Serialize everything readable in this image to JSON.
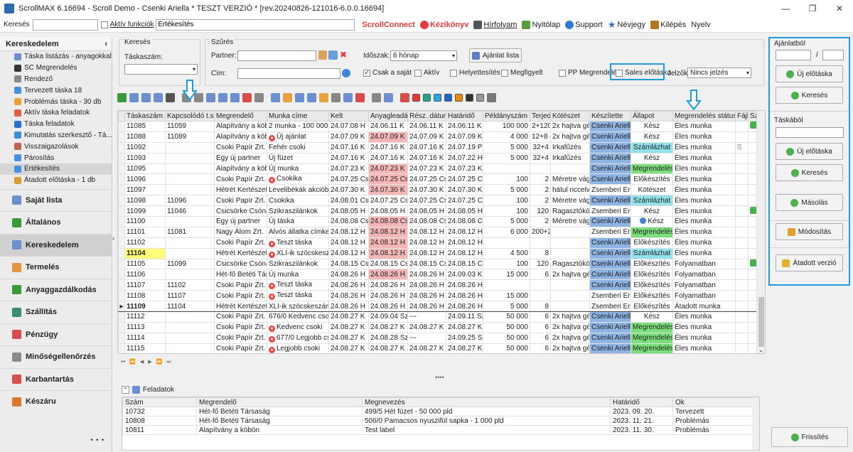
{
  "window": {
    "title": "ScrollMAX 6.16694 - Scroll Demo - Csenki Ariella * TESZT VERZIÓ * [rev.20240826-121016-6.0.0.16694]"
  },
  "menubar": {
    "search_label": "Keresés",
    "search_value": "",
    "active_label": "Aktív funkciók",
    "active_value": "Értékesítés",
    "items": [
      "ScrollConnect",
      "Kézikönyv",
      "Hírfolyam",
      "Nyitólap",
      "Support",
      "Névjegy",
      "Kilépés",
      "Nyelv"
    ]
  },
  "leftnav": {
    "section": "Kereskedelem",
    "subitems": [
      "Táska listázás - anyagokkal",
      "SC Megrendelés",
      "Rendező",
      "Tervezett táska 18",
      "Problémás táska - 30 db",
      "Aktív táska feladatok",
      "Táska feladatok",
      "Kimutatás szerkesztő - Tá...",
      "Visszaigazolások",
      "Párosítás",
      "Értékesítés",
      "Átadott előtáska - 1 db"
    ],
    "selected": "Értékesítés",
    "main": [
      "Saját lista",
      "Általános",
      "Kereskedelem",
      "Termelés",
      "Anyaggazdálkodás",
      "Szállítás",
      "Pénzügy",
      "Minőségellenőrzés",
      "Karbantartás",
      "Készáru"
    ],
    "active_main": "Kereskedelem",
    "more": "• • •",
    "collapse": "‹"
  },
  "search_box": {
    "legend": "Keresés",
    "field_label": "Táskaszám:",
    "field_value": ""
  },
  "filter_box": {
    "legend": "Szűrés",
    "partner_label": "Partner:",
    "partner_value": "",
    "cim_label": "Cím:",
    "cim_value": "",
    "period_label": "Időszak:",
    "period_value": "6 hónap",
    "offer_button": "Ajánlat lista",
    "checks": [
      {
        "label": "Csak a saját",
        "checked": true
      },
      {
        "label": "Aktív",
        "checked": false
      },
      {
        "label": "Helyettesítés",
        "checked": false
      },
      {
        "label": "Megfigyelt",
        "checked": false
      },
      {
        "label": "PP Megrendelés",
        "checked": false
      },
      {
        "label": "Sales előtáska",
        "checked": false
      }
    ],
    "jelzok_label": "Jelzők:",
    "jelzok_value": "Nincs jelzés"
  },
  "grid": {
    "columns": [
      "Táskaszám",
      "Kapcsolódó t.sz.",
      "Megrendelő",
      "Munka címe",
      "Kelt",
      "Anyagleadás",
      "Rész. dátum",
      "Határidő",
      "Példányszám",
      "Terjed",
      "Kötészet",
      "Készítette",
      "Állapot",
      "Megrendelés státusz",
      "Fájl",
      "Szer"
    ],
    "rows": [
      {
        "id": "11085",
        "rel": "11059",
        "client": "Alapítvány a köbör",
        "title": "2 munka - 100 000 +",
        "kelt": "24.07.08 H",
        "anyag": "24.06.11 K",
        "resz": "24.06.11 K",
        "hat": "24.06.11 K",
        "pld": "100 000",
        "terj": "2+120",
        "kot": "2x hajtva gén",
        "kesz": "Csenki Ariella",
        "all": "Kész",
        "stat": "Éles munka",
        "fajl": "",
        "szer": "puzzle",
        "dot": false,
        "anyagPink": false,
        "allC": ""
      },
      {
        "id": "11088",
        "rel": "11089",
        "client": "Alapítvány a köbör",
        "title": "Új ajánlat",
        "kelt": "24.07.09 K",
        "anyag": "24.07.09 K",
        "resz": "24.07.09 K",
        "hat": "24.07.09 K",
        "pld": "4 000",
        "terj": "12+8 c",
        "kot": "2x hajtva gén",
        "kesz": "Csenki Ariella",
        "all": "Kész",
        "stat": "Éles munka",
        "fajl": "",
        "szer": "",
        "dot": true,
        "anyagPink": true,
        "allC": ""
      },
      {
        "id": "11092",
        "rel": "",
        "client": "Csoki Papír Zrt.",
        "title": "Fehér csoki",
        "kelt": "24.07.16 K",
        "anyag": "24.07.16 K",
        "resz": "24.07.16 K",
        "hat": "24.07.19 P",
        "pld": "5 000",
        "terj": "32+4",
        "kot": "Irkafűzés",
        "kesz": "Csenki Ariella",
        "all": "Számlázhat",
        "stat": "Éles munka",
        "fajl": "clip",
        "szer": "",
        "dot": false,
        "anyagPink": false,
        "allC": "szamla"
      },
      {
        "id": "11093",
        "rel": "",
        "client": "Egy új partner",
        "title": "Új füzet",
        "kelt": "24.07.16 K",
        "anyag": "24.07.16 K",
        "resz": "24.07.16 K",
        "hat": "24.07.22 H",
        "pld": "5 000",
        "terj": "32+4",
        "kot": "Irkafűzés",
        "kesz": "Csenki Ariella",
        "all": "Kész",
        "stat": "Éles munka",
        "fajl": "",
        "szer": "",
        "dot": false,
        "anyagPink": false,
        "allC": ""
      },
      {
        "id": "11095",
        "rel": "",
        "client": "Alapítvány a köbör",
        "title": "Új munka",
        "kelt": "24.07.23 K",
        "anyag": "24.07.23 K",
        "resz": "24.07.23 K",
        "hat": "24.07.23 K",
        "pld": "",
        "terj": "",
        "kot": "",
        "kesz": "Csenki Ariella",
        "all": "Megrendelés",
        "stat": "Éles munka",
        "fajl": "",
        "szer": "",
        "dot": false,
        "anyagPink": true,
        "allC": "meg"
      },
      {
        "id": "11096",
        "rel": "",
        "client": "Csoki Papír Zrt.",
        "title": "Csokika",
        "kelt": "24.07.25 Cs",
        "anyag": "24.07.25 Cs",
        "resz": "24.07.25 Cs",
        "hat": "24.07.25 Cs",
        "pld": "100",
        "terj": "2",
        "kot": "Méretre vágva",
        "kesz": "Csenki Ariella",
        "all": "Előkészítés",
        "stat": "Éles munka",
        "fajl": "",
        "szer": "",
        "dot": true,
        "anyagPink": true,
        "allC": ""
      },
      {
        "id": "11097",
        "rel": "",
        "client": "Hétrét Kertészeti K",
        "title": "Levelibékák akcióban",
        "kelt": "24.07.30 K",
        "anyag": "24.07.30 K",
        "resz": "24.07.30 K",
        "hat": "24.07.30 K",
        "pld": "5 000",
        "terj": "2",
        "kot": "hátul riccelve,",
        "kesz": "Zsemberi Erika",
        "all": "Kötészet",
        "stat": "Éles munka",
        "fajl": "",
        "szer": "",
        "dot": false,
        "anyagPink": true,
        "allC": "",
        "keszPlain": true
      },
      {
        "id": "11098",
        "rel": "11096",
        "client": "Csoki Papír Zrt.",
        "title": "Csokika",
        "kelt": "24.08.01 Cs",
        "anyag": "24.07.25 Cs",
        "resz": "24.07.25 Cs",
        "hat": "24.07.25 Cs",
        "pld": "100",
        "terj": "2",
        "kot": "Méretre vágva",
        "kesz": "Csenki Ariella",
        "all": "Számlázhat",
        "stat": "Éles munka",
        "fajl": "",
        "szer": "",
        "dot": false,
        "anyagPink": false,
        "allC": "szamla"
      },
      {
        "id": "11099",
        "rel": "11046",
        "client": "Csicsörke Csónakh.",
        "title": "Szikraszilánkok",
        "kelt": "24.08.05 H",
        "anyag": "24.08.05 H",
        "resz": "24.08.05 H",
        "hat": "24.08.05 H",
        "pld": "100",
        "terj": "120",
        "kot": "Ragasztókötés",
        "kesz": "Zsemberi Erika",
        "all": "Kész",
        "stat": "Éles munka",
        "fajl": "",
        "szer": "puzzle",
        "dot": false,
        "anyagPink": false,
        "allC": "",
        "keszPlain": true
      },
      {
        "id": "11100",
        "rel": "",
        "client": "Egy új partner",
        "title": "Új táska",
        "kelt": "24.08.08 Cs",
        "anyag": "24.08.08 Cs",
        "resz": "24.08.08 Cs",
        "hat": "24.08.08 Cs",
        "pld": "5 000",
        "terj": "2",
        "kot": "Méretre vágva",
        "kesz": "Csenki Ariella",
        "all": "Kész",
        "stat": "Éles munka",
        "fajl": "",
        "szer": "",
        "dot": false,
        "anyagPink": true,
        "allC": "",
        "allIcon": true
      },
      {
        "id": "11101",
        "rel": "11081",
        "client": "Nagy Álom Zrt.",
        "title": "Alvós állatka címke",
        "kelt": "24.08.12 H",
        "anyag": "24.08.12 H",
        "resz": "24.08.12 H",
        "hat": "24.08.12 H",
        "pld": "6 000",
        "terj": "200+2",
        "kot": "",
        "kesz": "Zsemberi Erika",
        "all": "Megrendelés",
        "stat": "Éles munka",
        "fajl": "",
        "szer": "",
        "dot": false,
        "anyagPink": true,
        "allC": "meg",
        "keszPlain": true
      },
      {
        "id": "11102",
        "rel": "",
        "client": "Csoki Papír Zrt.",
        "title": "Teszt táska",
        "kelt": "24.08.12 H",
        "anyag": "24.08.12 H",
        "resz": "24.08.12 H",
        "hat": "24.08.12 H",
        "pld": "",
        "terj": "",
        "kot": "",
        "kesz": "Csenki Ariella",
        "all": "Előkészítés",
        "stat": "Éles munka",
        "fajl": "",
        "szer": "",
        "dot": true,
        "anyagPink": true,
        "allC": ""
      },
      {
        "id": "11104",
        "rel": "",
        "client": "Hétrét Kertészeti K",
        "title": "XLI-ik szöcskeszám",
        "kelt": "24.08.12 H",
        "anyag": "24.08.12 H",
        "resz": "24.08.12 H",
        "hat": "24.08.12 H",
        "pld": "4 500",
        "terj": "8",
        "kot": "",
        "kesz": "Csenki Ariella",
        "all": "Számlázhat",
        "stat": "Éles munka",
        "fajl": "",
        "szer": "",
        "dot": true,
        "anyagPink": true,
        "allC": "szamla",
        "idYellow": true
      },
      {
        "id": "11105",
        "rel": "11099",
        "client": "Csicsörke Csónakh.",
        "title": "Szikraszilánkok",
        "kelt": "24.08.15 Cs",
        "anyag": "24.08.15 Cs",
        "resz": "24.08.15 Cs",
        "hat": "24.08.15 Cs",
        "pld": "100",
        "terj": "120",
        "kot": "Ragasztókötés",
        "kesz": "Csenki Ariella",
        "all": "Előkészítés",
        "stat": "Folyamatban",
        "fajl": "",
        "szer": "puzzle",
        "dot": false,
        "anyagPink": false,
        "allC": ""
      },
      {
        "id": "11106",
        "rel": "",
        "client": "Hét-fő Betéti Társa",
        "title": "Új munka",
        "kelt": "24.08.26 H",
        "anyag": "24.08.26 H",
        "resz": "24.08.26 H",
        "hat": "24.09.03 K",
        "pld": "15 000",
        "terj": "6",
        "kot": "2x hajtva gén",
        "kesz": "Csenki Ariella",
        "all": "Előkészítés",
        "stat": "Folyamatban",
        "fajl": "",
        "szer": "",
        "dot": false,
        "anyagPink": true,
        "allC": ""
      },
      {
        "id": "11107",
        "rel": "11102",
        "client": "Csoki Papír Zrt.",
        "title": "Teszt táska",
        "kelt": "24.08.26 H",
        "anyag": "24.08.26 H",
        "resz": "24.08.26 H",
        "hat": "24.08.26 H",
        "pld": "",
        "terj": "",
        "kot": "",
        "kesz": "Csenki Ariella",
        "all": "Előkészítés",
        "stat": "Folyamatban",
        "fajl": "",
        "szer": "",
        "dot": true,
        "anyagPink": false,
        "allC": ""
      },
      {
        "id": "11108",
        "rel": "11107",
        "client": "Csoki Papír Zrt.",
        "title": "Teszt táska",
        "kelt": "24.08.26 H",
        "anyag": "24.08.26 H",
        "resz": "24.08.26 H",
        "hat": "24.08.26 H",
        "pld": "15 000",
        "terj": "",
        "kot": "",
        "kesz": "Zsemberi Erika",
        "all": "Előkészítés",
        "stat": "Folyamatban",
        "fajl": "",
        "szer": "",
        "dot": true,
        "anyagPink": false,
        "allC": "",
        "keszPlain": true
      },
      {
        "id": "11109",
        "rel": "11104",
        "client": "Hétrét Kertészeti K",
        "title": "XLI-ik szöcskeszámláló",
        "kelt": "24.08.26 H",
        "anyag": "24.08.26 H",
        "resz": "24.08.26 H",
        "hat": "24.08.26 H",
        "pld": "5 000",
        "terj": "8",
        "kot": "",
        "kesz": "Zsemberi Erika",
        "all": "Előkészítés",
        "stat": "Átadott munka",
        "fajl": "",
        "szer": "",
        "dot": false,
        "anyagPink": false,
        "allC": "",
        "keszPlain": true,
        "current": true
      },
      {
        "id": "11112",
        "rel": "",
        "client": "Csoki Papír Zrt.",
        "title": "676/0 Kedvenc csoki",
        "kelt": "24.08.27 K",
        "anyag": "24.09.04 Sze",
        "resz": "---",
        "hat": "24.09.11 Sz",
        "pld": "50 000",
        "terj": "6",
        "kot": "2x hajtva gén",
        "kesz": "Csenki Ariella",
        "all": "Kész",
        "stat": "Éles munka",
        "fajl": "",
        "szer": "",
        "dot": false,
        "anyagPink": false,
        "allC": ""
      },
      {
        "id": "11113",
        "rel": "",
        "client": "Csoki Papír Zrt.",
        "title": "Kedvenc csoki",
        "kelt": "24.08.27 K",
        "anyag": "24.08.27 K",
        "resz": "24.08.27 K",
        "hat": "24.08.27 K",
        "pld": "50 000",
        "terj": "6",
        "kot": "2x hajtva gén",
        "kesz": "Csenki Ariella",
        "all": "Megrendelés",
        "stat": "Éles munka",
        "fajl": "",
        "szer": "",
        "dot": true,
        "anyagPink": false,
        "allC": "meg"
      },
      {
        "id": "11114",
        "rel": "",
        "client": "Csoki Papír Zrt.",
        "title": "677/0 Legjobb csok",
        "kelt": "24.08.27 K",
        "anyag": "24.08.28 Sze",
        "resz": "---",
        "hat": "24.09.25 Sz",
        "pld": "50 000",
        "terj": "6",
        "kot": "2x hajtva gén",
        "kesz": "Csenki Ariella",
        "all": "Megrendelés",
        "stat": "Éles munka",
        "fajl": "",
        "szer": "",
        "dot": true,
        "anyagPink": false,
        "allC": "meg"
      },
      {
        "id": "11115",
        "rel": "",
        "client": "Csoki Papír Zrt.",
        "title": "Legjobb csoki",
        "kelt": "24.08.27 K",
        "anyag": "24.08.27 K",
        "resz": "24.08.27 K",
        "hat": "24.08.27 K",
        "pld": "50 000",
        "terj": "6",
        "kot": "2x hajtva gén",
        "kesz": "Csenki Ariella",
        "all": "Megrendelés",
        "stat": "Éles munka",
        "fajl": "",
        "szer": "",
        "dot": true,
        "anyagPink": false,
        "allC": "meg"
      }
    ],
    "nav": "⏮ ⏪ ◀ ▶ ⏩ ⏭"
  },
  "tasks": {
    "title": "Feladatok",
    "columns": [
      "Szám",
      "Megrendelő",
      "Megnevezés",
      "Határidő",
      "Ok"
    ],
    "rows": [
      [
        "10732",
        "Hét-fő Betéti Társaság",
        "499/5 Hét füzet - 50 000 pld",
        "2023. 09. 20.",
        "Tervezett"
      ],
      [
        "10808",
        "Hét-fő Betéti Társaság",
        "506/0 Pamacsos nyuszifül sapka - 1 000 pld",
        "2023. 11. 21.",
        "Problémás"
      ],
      [
        "10811",
        "Alapítvány a köbön",
        "Test label",
        "2023. 11. 30.",
        "Problémás"
      ]
    ]
  },
  "rightpanel": {
    "offer_title": "Ajánlatból",
    "offer_sep": "/",
    "new_pre": "Új előtáska",
    "search": "Keresés",
    "bag_title": "Táskából",
    "new_pre2": "Új előtáska",
    "search2": "Keresés",
    "copy": "Másolás",
    "modify": "Módosítás",
    "handed": "Átadott verzió",
    "refresh": "Frissítés"
  },
  "colors": {
    "accent": "#1e9ae0",
    "pink": "#f4b6b6",
    "csenki": "#8eb4e3",
    "szamla": "#92e2ec",
    "megrendeles": "#7be07b",
    "highlight": "#ffff77"
  }
}
